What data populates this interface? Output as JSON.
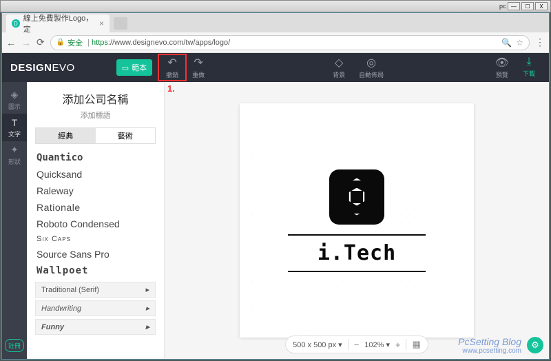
{
  "window": {
    "pc_label": "pc",
    "min": "—",
    "max": "☐",
    "close": "X"
  },
  "browser": {
    "tab_title": "線上免費製作Logo，定",
    "favicon": "D",
    "secure_label": "安全",
    "url_https": "https",
    "url_rest": "://www.designevo.com/tw/apps/logo/"
  },
  "header": {
    "brand_design": "DESIGN",
    "brand_evo": "EVO",
    "template_btn": "範本",
    "undo": "撤銷",
    "redo": "重做",
    "background": "背景",
    "layout": "自動佈局",
    "preview": "預覽",
    "download": "下載"
  },
  "annotation": {
    "one": "1."
  },
  "sidetabs": {
    "icon": "圖示",
    "text": "文字",
    "shape": "形狀",
    "register": "註冊"
  },
  "leftpanel": {
    "company": "添加公司名稱",
    "slogan": "添加標語",
    "tab_classic": "經典",
    "tab_art": "藝術",
    "fonts": [
      "Quantico",
      "Quicksand",
      "Raleway",
      "Rationale",
      "Roboto Condensed",
      "Six Caps",
      "Source Sans Pro",
      "Wallpoet"
    ],
    "cat_serif": "Traditional (Serif)",
    "cat_hand": "Handwriting",
    "cat_funny": "Funny"
  },
  "canvas": {
    "logo_text": "i.Tech"
  },
  "zoombar": {
    "size": "500 x 500 px",
    "zoom": "102%"
  },
  "watermark": {
    "title": "PcSetting Blog",
    "url": "www.pcsetting.com"
  }
}
